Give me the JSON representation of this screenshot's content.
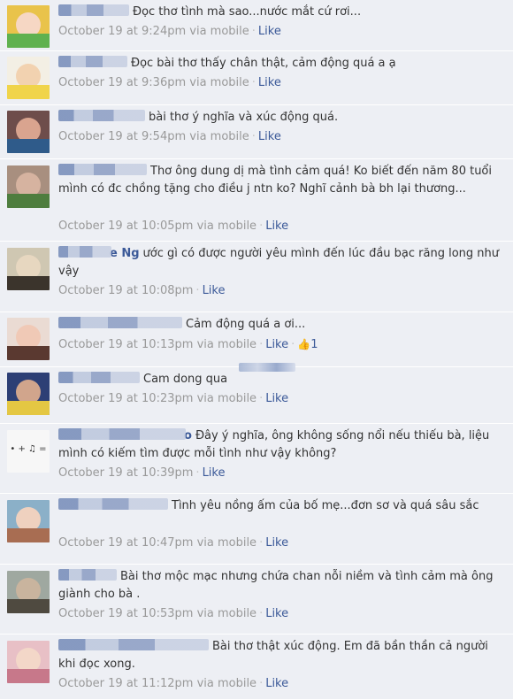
{
  "comments": [
    {
      "text": "Đọc thơ tình mà sao...nước mắt cứ rơi...",
      "author_suffix": "",
      "time": "October 19 at 9:24pm",
      "via": "via mobile",
      "like": "Like",
      "likes": "",
      "author_w": 80,
      "avatar": [
        "#e9c34b",
        "#f6d7c4",
        "#5fb14f"
      ]
    },
    {
      "text": "Đọc bài thơ thấy chân thật, cảm động quá a ạ",
      "author_suffix": "",
      "time": "October 19 at 9:36pm",
      "via": "via mobile",
      "like": "Like",
      "likes": "",
      "author_w": 78,
      "avatar": [
        "#f3efe4",
        "#f2d2b0",
        "#f0d44a"
      ]
    },
    {
      "text": "bài thơ ý nghĩa và xúc động quá.",
      "author_suffix": "",
      "time": "October 19 at 9:54pm",
      "via": "via mobile",
      "like": "Like",
      "likes": "",
      "author_w": 98,
      "avatar": [
        "#6e4d4b",
        "#d9a48f",
        "#2f5b8a"
      ]
    },
    {
      "text": "Thơ ông dung dị mà tình cảm quá! Ko biết đến năm 80 tuổi mình có đc chồng tặng cho điều j ntn ko? Nghĩ cảnh bà bh lại thương...",
      "author_suffix": "",
      "time": "October 19 at 10:05pm",
      "via": "via mobile",
      "like": "Like",
      "likes": "",
      "author_w": 100,
      "avatar": [
        "#a88f7f",
        "#d6b3a0",
        "#4e7d3e"
      ]
    },
    {
      "text": "ước gì có được người yêu mình đến lúc đầu bạc răng long như vậy",
      "author_suffix": "e Ng",
      "time": "October 19 at 10:08pm",
      "via": "",
      "like": "Like",
      "likes": "",
      "author_w": 60,
      "avatar": [
        "#cfc7b2",
        "#e7d7c0",
        "#3b342c"
      ]
    },
    {
      "text": "Cảm động quá a ơi...",
      "author_suffix": "",
      "time": "October 19 at 10:13pm",
      "via": "via mobile",
      "like": "Like",
      "likes": "1",
      "author_w": 140,
      "avatar": [
        "#eadbd3",
        "#f0c9b6",
        "#5a3930"
      ]
    },
    {
      "text": "Cam dong qua",
      "author_suffix": "",
      "time": "October 19 at 10:23pm",
      "via": "via mobile",
      "like": "Like",
      "likes": "",
      "author_w": 92,
      "avatar": [
        "#2d3f75",
        "#d1a58c",
        "#e4c743"
      ]
    },
    {
      "text": "Đây ý nghĩa, ông không sống nổi nếu thiếu bà, liệu mình có kiếm tìm được mỗi tình như vậy không?",
      "author_suffix": "o",
      "time": "October 19 at 10:39pm",
      "via": "",
      "like": "Like",
      "likes": "",
      "author_w": 144,
      "avatar": [
        "#f7f7f7",
        "#f7f7f7",
        "#f0f0f0"
      ],
      "glyph": "• + ♫ ="
    },
    {
      "text": "Tình yêu nồng ấm của bố mẹ...đơn sơ và quá sâu sắc",
      "author_suffix": "",
      "time": "October 19 at 10:47pm",
      "via": "via mobile",
      "like": "Like",
      "likes": "",
      "author_w": 124,
      "avatar": [
        "#8bb0c8",
        "#efd1bf",
        "#a86d52"
      ]
    },
    {
      "text": "Bài thơ mộc mạc nhưng chứa chan nỗi niềm và tình cảm mà ông giành cho bà .",
      "author_suffix": "",
      "time": "October 19 at 10:53pm",
      "via": "via mobile",
      "like": "Like",
      "likes": "",
      "author_w": 66,
      "avatar": [
        "#9fa8a0",
        "#c9b49e",
        "#4f4a40"
      ]
    },
    {
      "text": "Bài thơ thật xúc động. Em đã bần thần cả người khi đọc xong.",
      "author_suffix": "",
      "time": "October 19 at 11:12pm",
      "via": "via mobile",
      "like": "Like",
      "likes": "",
      "author_w": 170,
      "avatar": [
        "#e8c0c6",
        "#f3d7c8",
        "#c7788a"
      ]
    }
  ]
}
